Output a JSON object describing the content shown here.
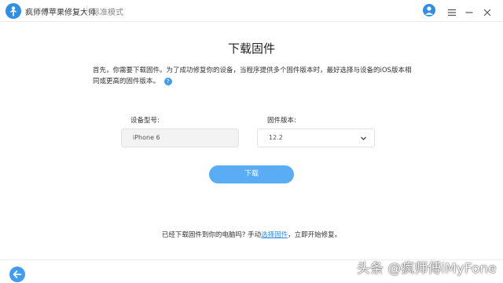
{
  "titlebar": {
    "app_title": "疯师傅苹果修复大师",
    "mode_label": "标准模式"
  },
  "main": {
    "heading": "下载固件",
    "description": "首先，你需要下载固件。为了成功修复你的设备，当程序提供多个固件版本时，最好选择与设备的iOS版本相同或更高的固件版本。",
    "model_label": "设备型号:",
    "model_value": "iPhone 6",
    "version_label": "固件版本:",
    "version_value": "12.2",
    "download_label": "下载"
  },
  "bottom_note": {
    "prefix": "已经下载固件到你的电脑吗? 手动",
    "link": "选择固件",
    "suffix": "，立即开始修复。"
  },
  "watermark": "头条 @疯师傅iMyFone",
  "colors": {
    "accent": "#2f8fe6",
    "button": "#5aacf4"
  },
  "icons": [
    "app-logo-icon",
    "user-icon",
    "menu-icon",
    "minimize-icon",
    "close-icon",
    "help-icon",
    "chevron-down-icon",
    "back-arrow-icon"
  ]
}
